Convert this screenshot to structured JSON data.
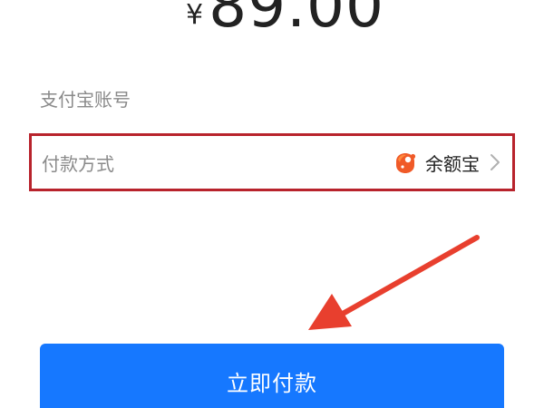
{
  "amount": {
    "currency": "¥",
    "value": "89.00"
  },
  "form": {
    "account_label": "支付宝账号",
    "payment_method_label": "付款方式",
    "payment_method_value": "余额宝"
  },
  "actions": {
    "pay_label": "立即付款"
  },
  "icons": {
    "payment_method_icon": "yuebao-icon",
    "row_chevron": "chevron-right-icon",
    "annotation": "red-arrow-icon"
  },
  "colors": {
    "primary_blue": "#1678ff",
    "highlight_red": "#b8232c",
    "icon_orange": "#f05a28",
    "text_dark": "#222222",
    "text_muted": "#8a8a8a"
  }
}
